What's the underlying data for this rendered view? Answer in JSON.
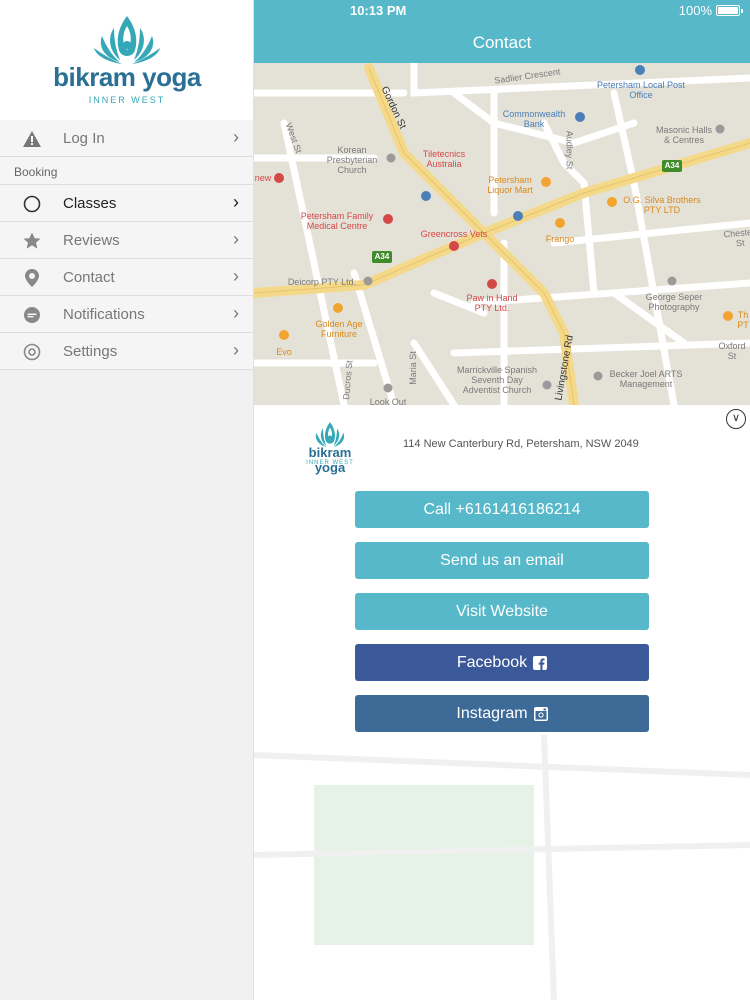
{
  "status_bar": {
    "time": "10:13 PM",
    "battery": "100%"
  },
  "nav": {
    "title": "Contact"
  },
  "brand": {
    "name": "bikram yoga",
    "sub": "INNER WEST",
    "color": "#2a6f94",
    "accent": "#35a8b8"
  },
  "sidebar": {
    "login": {
      "label": "Log In",
      "icon": "warning-icon"
    },
    "section": "Booking",
    "items": [
      {
        "label": "Classes",
        "icon": "circle-icon",
        "active": true
      },
      {
        "label": "Reviews",
        "icon": "star-icon"
      },
      {
        "label": "Contact",
        "icon": "location-pin-icon"
      },
      {
        "label": "Notifications",
        "icon": "chat-bubble-icon"
      },
      {
        "label": "Settings",
        "icon": "gear-icon"
      }
    ]
  },
  "map": {
    "streets": [
      "Gordon St",
      "Sadlier Crescent",
      "West St",
      "Audley St",
      "Livingstone Rd",
      "Maria St",
      "Ducros St",
      "Oxford St",
      "Chester St"
    ],
    "road_badges": [
      "A34",
      "A34"
    ],
    "places": [
      "Petersham Local Post Office",
      "Commonwealth Bank",
      "Masonic Halls & Centres",
      "Korean Presbyterian Church",
      "Tiletecnics Australia",
      "Petersham Liquor Mart",
      "O.G. Silva Brothers PTY LTD",
      "Petersham Family Medical Centre",
      "Greencross Vets",
      "Frango",
      "Deicorp PTY Ltd.",
      "Paw in Hand PTY Ltd.",
      "George Seper Photography",
      "Golden Age Furniture",
      "Evo",
      "Marrickville Spanish Seventh Day Adventist Church",
      "Becker Joel ARTS Management",
      "Look Out",
      "new",
      "Th PT"
    ]
  },
  "contact": {
    "address": "114 New Canterbury Rd, Petersham, NSW 2049",
    "buttons": {
      "call": "Call +6161416186214",
      "email": "Send us an email",
      "website": "Visit Website",
      "facebook": "Facebook",
      "instagram": "Instagram"
    }
  },
  "colors": {
    "nav": "#56b8c9",
    "facebook": "#3b5998",
    "instagram": "#3e6a97"
  }
}
